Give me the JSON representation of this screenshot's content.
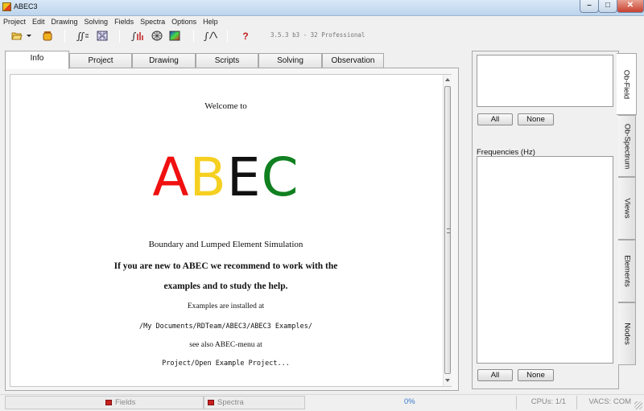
{
  "window": {
    "title": "ABEC3",
    "app_icon": "abec-app-icon"
  },
  "menu": [
    "Project",
    "Edit",
    "Drawing",
    "Solving",
    "Fields",
    "Spectra",
    "Options",
    "Help"
  ],
  "toolbar": {
    "buttons": [
      "open-folder-icon",
      "dropdown-arrow-icon",
      "save-jar-icon",
      "integral-solve-icon",
      "mesh-grid-icon",
      "field-solve-icon",
      "mesh-view-icon",
      "color-map-icon",
      "spectrum-solve-icon",
      "help-question-icon"
    ],
    "version": "3.5.3 b3 - 32 Professional"
  },
  "left_tabs": [
    "Info",
    "Project",
    "Drawing",
    "Scripts",
    "Solving",
    "Observation"
  ],
  "info": {
    "welcome": "Welcome to",
    "logo": [
      "A",
      "B",
      "E",
      "C"
    ],
    "logo_colors": [
      "#f01010",
      "#f5d020",
      "#111111",
      "#108020"
    ],
    "subtitle": "Boundary and Lumped Element Simulation",
    "line1": "If you are new to ABEC we recommend to work with the",
    "line2": "examples and to study the help.",
    "examples_note": "Examples are installed at",
    "examples_path": "/My Documents/RDTeam/ABEC3/ABEC3 Examples/",
    "menu_note": "see also ABEC-menu at",
    "menu_path": "Project/Open Example Project..."
  },
  "right_panel": {
    "all_label": "All",
    "none_label": "None",
    "frequencies_label": "Frequencies  (Hz)",
    "vertical_tabs": [
      "Ob-Field",
      "Ob-Spectrum",
      "Views",
      "Elements",
      "Nodes"
    ]
  },
  "status": {
    "fields": "Fields",
    "spectra": "Spectra",
    "progress": "0%",
    "cpus": "CPUs: 1/1",
    "vacs": "VACS: COM"
  }
}
